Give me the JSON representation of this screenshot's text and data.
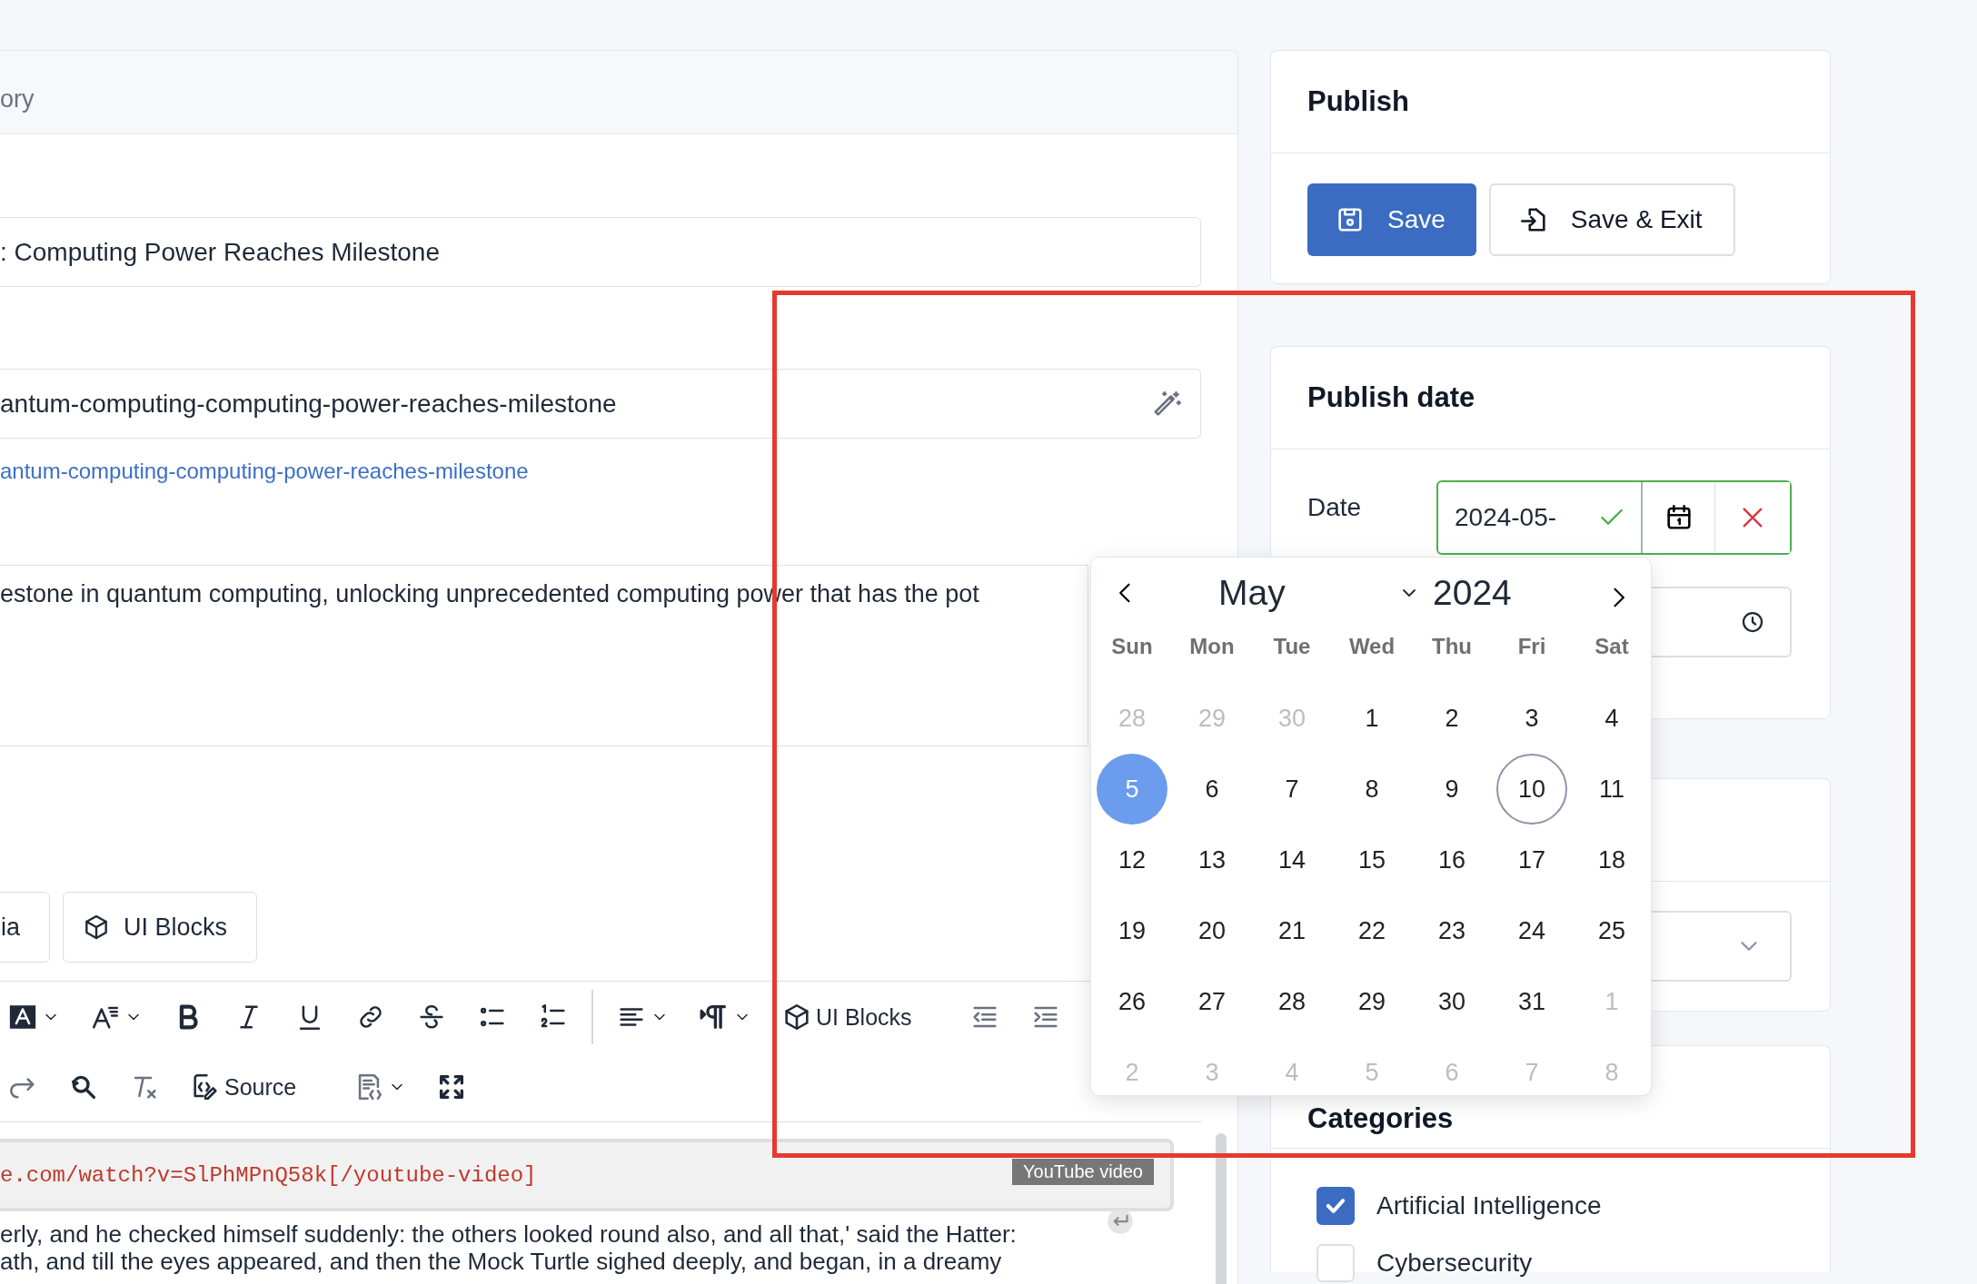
{
  "main": {
    "header": "ory",
    "title_field": {
      "value": ": Computing Power Reaches Milestone"
    },
    "slug_field": {
      "value": "antum-computing-computing-power-reaches-milestone"
    },
    "slug_link": "antum-computing-computing-power-reaches-milestone",
    "excerpt": "estone in quantum computing, unlocking unprecedented computing power that has the pot",
    "media_buttons": [
      {
        "label": "ia",
        "kind": "media"
      },
      {
        "label": "UI Blocks",
        "kind": "blocks"
      }
    ],
    "toolbar_rows": [
      [
        {
          "kind": "font-color",
          "dropdown": true
        },
        {
          "kind": "font-size",
          "dropdown": true
        },
        {
          "kind": "bold"
        },
        {
          "kind": "italic"
        },
        {
          "kind": "underline"
        },
        {
          "kind": "link"
        },
        {
          "kind": "strike"
        },
        {
          "kind": "bullets"
        },
        {
          "kind": "numbers"
        },
        {
          "kind": "separator"
        },
        {
          "kind": "align",
          "dropdown": true
        },
        {
          "kind": "paragraph",
          "dropdown": true
        },
        {
          "kind": "ui-blocks",
          "label": "UI Blocks"
        },
        {
          "kind": "outdent"
        },
        {
          "kind": "indent"
        }
      ],
      [
        {
          "kind": "redo"
        },
        {
          "kind": "find"
        },
        {
          "kind": "clear-format"
        },
        {
          "kind": "source",
          "label": "Source"
        },
        {
          "kind": "template",
          "dropdown": true
        },
        {
          "kind": "fullscreen"
        }
      ]
    ],
    "code_block": {
      "text": "e.com/watch?v=SlPhMPnQ58k[/youtube-video]",
      "tag": "YouTube video"
    },
    "paragraph": [
      "erly, and he checked himself suddenly: the others looked round also, and all that,' said the Hatter:",
      "ath, and till the eyes appeared, and then the Mock Turtle sighed deeply, and began, in a dreamy"
    ]
  },
  "publish": {
    "title": "Publish",
    "buttons": [
      {
        "label": "Save",
        "kind": "primary"
      },
      {
        "label": "Save & Exit",
        "kind": "secondary"
      }
    ]
  },
  "publish_date": {
    "title": "Publish date",
    "date_label": "Date",
    "date_value": "2024-05-",
    "valid": true
  },
  "categories": {
    "title": "Categories",
    "items": [
      {
        "label": "Artificial Intelligence",
        "checked": true
      },
      {
        "label": "Cybersecurity",
        "checked": false
      }
    ]
  },
  "calendar": {
    "month": "May",
    "year": "2024",
    "weekdays": [
      "Sun",
      "Mon",
      "Tue",
      "Wed",
      "Thu",
      "Fri",
      "Sat"
    ],
    "weeks": [
      [
        {
          "day": "28",
          "outside": true,
          "selected": false,
          "today": false
        },
        {
          "day": "29",
          "outside": true,
          "selected": false,
          "today": false
        },
        {
          "day": "30",
          "outside": true,
          "selected": false,
          "today": false
        },
        {
          "day": "1",
          "outside": false,
          "selected": false,
          "today": false
        },
        {
          "day": "2",
          "outside": false,
          "selected": false,
          "today": false
        },
        {
          "day": "3",
          "outside": false,
          "selected": false,
          "today": false
        },
        {
          "day": "4",
          "outside": false,
          "selected": false,
          "today": false
        }
      ],
      [
        {
          "day": "5",
          "outside": false,
          "selected": true,
          "today": false
        },
        {
          "day": "6",
          "outside": false,
          "selected": false,
          "today": false
        },
        {
          "day": "7",
          "outside": false,
          "selected": false,
          "today": false
        },
        {
          "day": "8",
          "outside": false,
          "selected": false,
          "today": false
        },
        {
          "day": "9",
          "outside": false,
          "selected": false,
          "today": false
        },
        {
          "day": "10",
          "outside": false,
          "selected": false,
          "today": true
        },
        {
          "day": "11",
          "outside": false,
          "selected": false,
          "today": false
        }
      ],
      [
        {
          "day": "12",
          "outside": false,
          "selected": false,
          "today": false
        },
        {
          "day": "13",
          "outside": false,
          "selected": false,
          "today": false
        },
        {
          "day": "14",
          "outside": false,
          "selected": false,
          "today": false
        },
        {
          "day": "15",
          "outside": false,
          "selected": false,
          "today": false
        },
        {
          "day": "16",
          "outside": false,
          "selected": false,
          "today": false
        },
        {
          "day": "17",
          "outside": false,
          "selected": false,
          "today": false
        },
        {
          "day": "18",
          "outside": false,
          "selected": false,
          "today": false
        }
      ],
      [
        {
          "day": "19",
          "outside": false,
          "selected": false,
          "today": false
        },
        {
          "day": "20",
          "outside": false,
          "selected": false,
          "today": false
        },
        {
          "day": "21",
          "outside": false,
          "selected": false,
          "today": false
        },
        {
          "day": "22",
          "outside": false,
          "selected": false,
          "today": false
        },
        {
          "day": "23",
          "outside": false,
          "selected": false,
          "today": false
        },
        {
          "day": "24",
          "outside": false,
          "selected": false,
          "today": false
        },
        {
          "day": "25",
          "outside": false,
          "selected": false,
          "today": false
        }
      ],
      [
        {
          "day": "26",
          "outside": false,
          "selected": false,
          "today": false
        },
        {
          "day": "27",
          "outside": false,
          "selected": false,
          "today": false
        },
        {
          "day": "28",
          "outside": false,
          "selected": false,
          "today": false
        },
        {
          "day": "29",
          "outside": false,
          "selected": false,
          "today": false
        },
        {
          "day": "30",
          "outside": false,
          "selected": false,
          "today": false
        },
        {
          "day": "31",
          "outside": false,
          "selected": false,
          "today": false
        },
        {
          "day": "1",
          "outside": true,
          "selected": false,
          "today": false
        }
      ],
      [
        {
          "day": "2",
          "outside": true,
          "selected": false,
          "today": false
        },
        {
          "day": "3",
          "outside": true,
          "selected": false,
          "today": false
        },
        {
          "day": "4",
          "outside": true,
          "selected": false,
          "today": false
        },
        {
          "day": "5",
          "outside": true,
          "selected": false,
          "today": false
        },
        {
          "day": "6",
          "outside": true,
          "selected": false,
          "today": false
        },
        {
          "day": "7",
          "outside": true,
          "selected": false,
          "today": false
        },
        {
          "day": "8",
          "outside": true,
          "selected": false,
          "today": false
        }
      ]
    ]
  },
  "highlight_frame": true
}
